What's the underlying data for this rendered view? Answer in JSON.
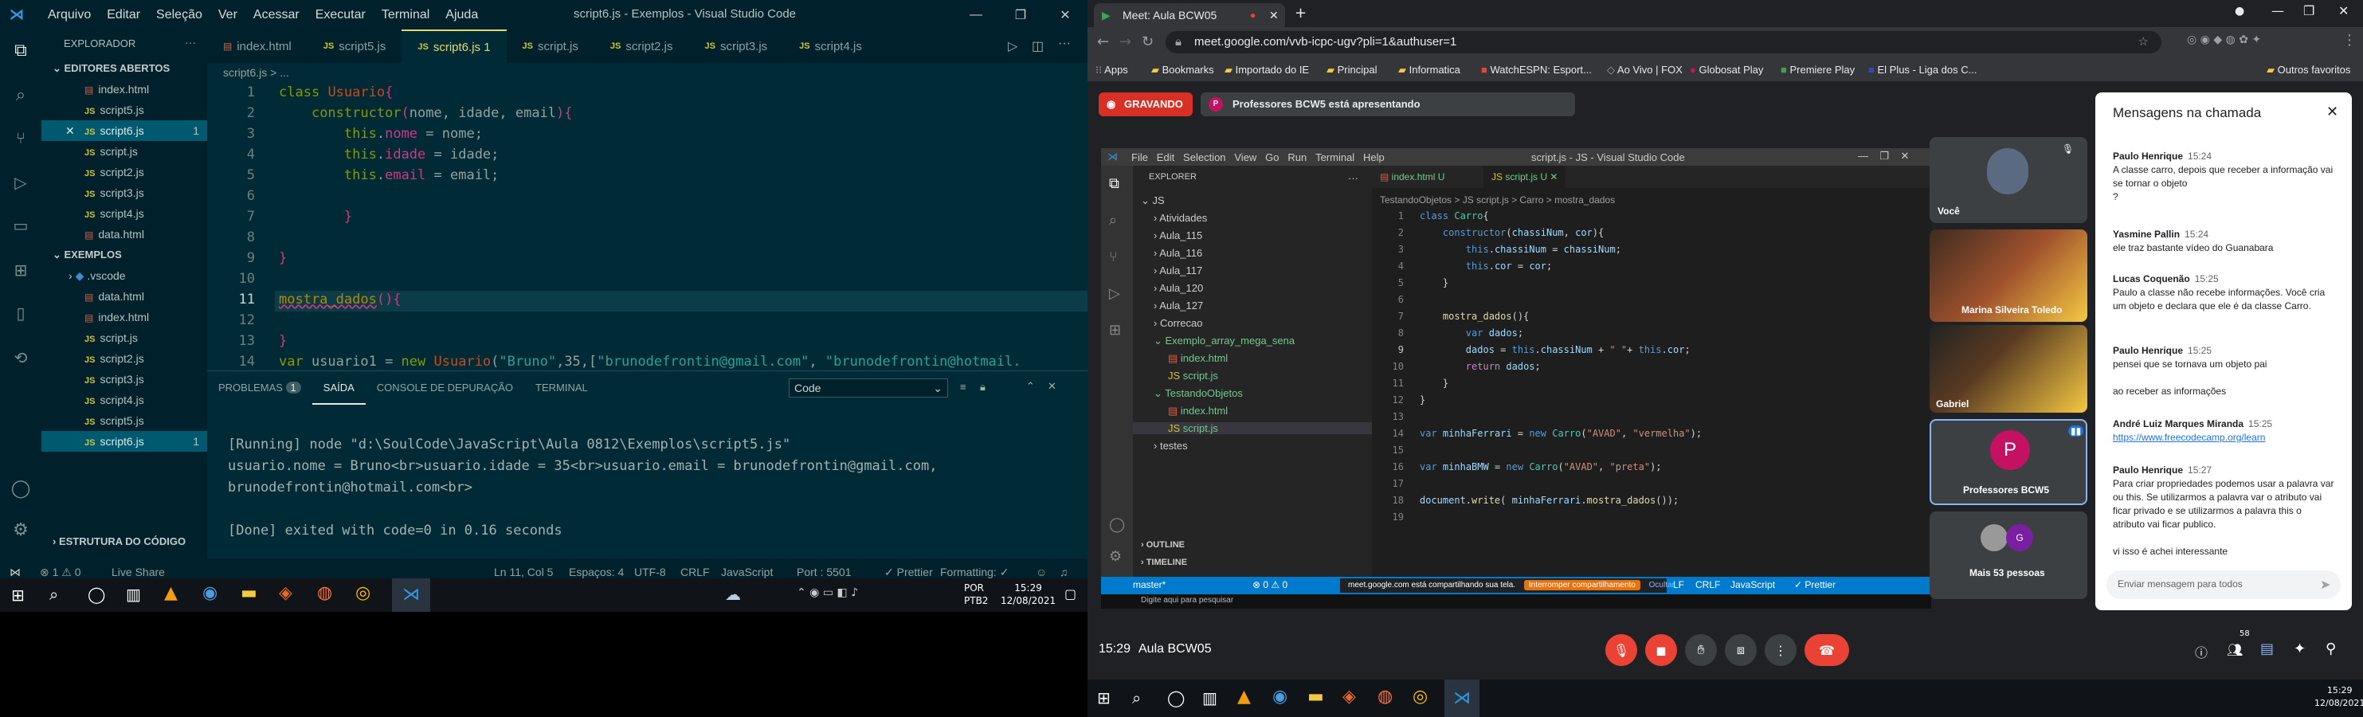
{
  "left": {
    "menu": [
      "Arquivo",
      "Editar",
      "Seleção",
      "Ver",
      "Acessar",
      "Executar",
      "Terminal",
      "Ajuda"
    ],
    "title": "script6.js - Exemplos - Visual Studio Code",
    "explorer": "EXPLORADOR",
    "open_editors": "EDITORES ABERTOS",
    "open_files": [
      {
        "name": "index.html",
        "type": "html"
      },
      {
        "name": "script5.js",
        "type": "js"
      },
      {
        "name": "script6.js",
        "type": "js",
        "badge": "1"
      },
      {
        "name": "script.js",
        "type": "js"
      },
      {
        "name": "script2.js",
        "type": "js"
      },
      {
        "name": "script3.js",
        "type": "js"
      },
      {
        "name": "script4.js",
        "type": "js"
      },
      {
        "name": "data.html",
        "type": "html"
      }
    ],
    "examples": "EXEMPLOS",
    "example_files": [
      ".vscode",
      "data.html",
      "index.html",
      "script.js",
      "script2.js",
      "script3.js",
      "script4.js",
      "script5.js",
      "script6.js"
    ],
    "outline": "ESTRUTURA DO CÓDIGO",
    "tabs": [
      "index.html",
      "script5.js",
      "script6.js 1",
      "script.js",
      "script2.js",
      "script3.js",
      "script4.js"
    ],
    "breadcrumb": "script6.js > ...",
    "line_numbers": [
      "1",
      "2",
      "3",
      "4",
      "5",
      "6",
      "7",
      "8",
      "9",
      "10",
      "11",
      "12",
      "13",
      "14"
    ],
    "panel_tabs": [
      "PROBLEMAS",
      "1",
      "SAÍDA",
      "CONSOLE DE DEPURAÇÃO",
      "TERMINAL"
    ],
    "output_select": "Code",
    "output": [
      "[Running] node \"d:\\SoulCode\\JavaScript\\Aula 0812\\Exemplos\\script5.js\"",
      "usuario.nome = Bruno<br>usuario.idade = 35<br>usuario.email = brunodefrontin@gmail.com,",
      "brunodefrontin@hotmail.com<br>",
      "",
      "[Done] exited with code=0 in 0.16 seconds"
    ],
    "status": {
      "errors": "⊗ 1 ⚠ 0",
      "live": "Live Share",
      "pos": "Ln 11, Col 5",
      "spaces": "Espaços: 4",
      "enc": "UTF-8",
      "eol": "CRLF",
      "lang": "JavaScript",
      "port": "Port : 5501",
      "prettier": "✓ Prettier",
      "fmt": "Formatting: ✓"
    },
    "clock": {
      "time": "15:29",
      "date": "12/08/2021",
      "lang": "POR\nPTB2"
    }
  },
  "right": {
    "tab_title": "Meet: Aula BCW05",
    "url": "meet.google.com/vvb-icpc-ugv?pli=1&authuser=1",
    "bookmarks": [
      "Apps",
      "Bookmarks",
      "Importado do IE",
      "Principal",
      "Informatica",
      "WatchESPN: Esport...",
      "Ao Vivo | FOX",
      "Globosat Play",
      "Premiere Play",
      "El Plus - Liga dos C...",
      "Outros favoritos"
    ],
    "recording": "GRAVANDO",
    "presenting": "Professores BCW5 está apresentando",
    "participants": [
      "Você",
      "Marina Silveira Toledo",
      "Gabriel",
      "Professores BCW5",
      "Mais 53 pessoas"
    ],
    "chat_title": "Mensagens na chamada",
    "messages": [
      {
        "who": "Paulo Henrique",
        "time": "15:24",
        "text": "A classe carro, depois que receber a informação vai se tornar o objeto\n?"
      },
      {
        "who": "Yasmine Pallin",
        "time": "15:24",
        "text": "ele traz bastante vídeo do Guanabara"
      },
      {
        "who": "Lucas Coquenão",
        "time": "15:25",
        "text": "Paulo a classe não recebe informações. Você cria um objeto e declara que ele é da classe Carro."
      },
      {
        "who": "Paulo Henrique",
        "time": "15:25",
        "text": "pensei que se tornava um objeto pai\n\nao receber as informações"
      },
      {
        "who": "André Luiz Marques Miranda",
        "time": "15:25",
        "text": "https://www.freecodecamp.org/learn"
      },
      {
        "who": "Paulo Henrique",
        "time": "15:27",
        "text": "Para criar propriedades podemos usar a palavra var ou this. Se utilizarmos a palavra var o atributo vai ficar privado e se utilizarmos a palavra this o atributo vai ficar publico.\n\nvi isso é achei interessante"
      }
    ],
    "chat_input": "Enviar mensagem para todos",
    "meeting_time": "15:29",
    "meeting_name": "Aula BCW05",
    "people_count": "58",
    "clock": {
      "time": "15:29",
      "date": "12/08/2021"
    },
    "inner": {
      "menu": [
        "File",
        "Edit",
        "Selection",
        "View",
        "Go",
        "Run",
        "Terminal",
        "Help"
      ],
      "title": "script.js - JS - Visual Studio Code",
      "explorer": "EXPLORER",
      "tabs": [
        "index.html U",
        "script.js U"
      ],
      "breadcrumb": "TestandoObjetos > JS script.js > Carro > mostra_dados",
      "tree": [
        "JS",
        "Atividades",
        "Aula_115",
        "Aula_116",
        "Aula_117",
        "Aula_120",
        "Aula_127",
        "Correcao",
        "Exemplo_array_mega_sena",
        "index.html",
        "script.js",
        "TestandoObjetos",
        "index.html",
        "script.js",
        "testes"
      ],
      "outline": "OUTLINE",
      "timeline": "TIMELINE",
      "status": [
        "master*",
        "⊗ 0 ⚠ 0",
        "LF",
        "CRLF",
        "JavaScript",
        "✓ Prettier"
      ],
      "share_text": "meet.google.com está compartilhando sua tela.",
      "stop_share": "Interromper compartilhamento",
      "hide": "Ocultar",
      "search": "Digite aqui para pesquisar",
      "clock": "15:29\n12/08/2021"
    }
  }
}
